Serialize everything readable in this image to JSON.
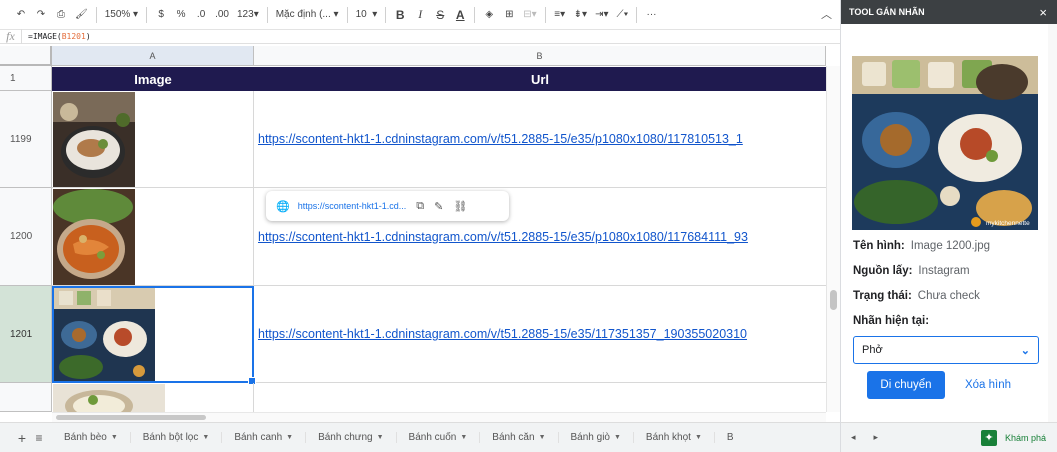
{
  "toolbar": {
    "zoom": "150%",
    "currency": "$",
    "percent": "%",
    "dec_less": ".0",
    "dec_more": ".00",
    "format_more": "123",
    "font": "Mặc định (...",
    "font_size": "10",
    "bold": "B",
    "italic": "I",
    "strike": "S",
    "underline": "A"
  },
  "formula": {
    "fx": "fx",
    "prefix": "=IMAGE(",
    "ref": "B1201",
    "suffix": ")"
  },
  "columns": [
    "A",
    "B"
  ],
  "header_row": {
    "num": "1",
    "col_a": "Image",
    "col_b": "Url"
  },
  "rows": [
    {
      "num": "1199",
      "url": "https://scontent-hkt1-1.cdninstagram.com/v/t51.2885-15/e35/p1080x1080/117810513_1"
    },
    {
      "num": "1200",
      "url": "https://scontent-hkt1-1.cdninstagram.com/v/t51.2885-15/e35/p1080x1080/117684111_93"
    },
    {
      "num": "1201",
      "url": "https://scontent-hkt1-1.cdninstagram.com/v/t51.2885-15/e35/117351357_190355020310"
    }
  ],
  "link_popup": {
    "text": "https://scontent-hkt1-1.cd..."
  },
  "tabs": {
    "add": "+",
    "menu": "≡",
    "items": [
      "Bánh bèo",
      "Bánh bột lọc",
      "Bánh canh",
      "Bánh chưng",
      "Bánh cuốn",
      "Bánh căn",
      "Bánh giò",
      "Bánh khọt",
      "B"
    ]
  },
  "panel": {
    "title": "TOOL GÁN NHÃN",
    "close": "×",
    "watermark": "mykitchennette",
    "name_label": "Tên hình:",
    "name_value": "Image 1200.jpg",
    "source_label": "Nguồn lấy:",
    "source_value": "Instagram",
    "status_label": "Trạng thái:",
    "status_value": "Chưa check",
    "current_label": "Nhãn hiện tại:",
    "selected_label": "Phở",
    "move_button": "Di chuyển",
    "delete_button": "Xóa hình"
  },
  "explore": "Khám phá",
  "colors": {
    "header_bg": "#1f1a4f",
    "accent": "#1a73e8",
    "selected_row": "#d3e3d7",
    "explore_green": "#188038"
  }
}
